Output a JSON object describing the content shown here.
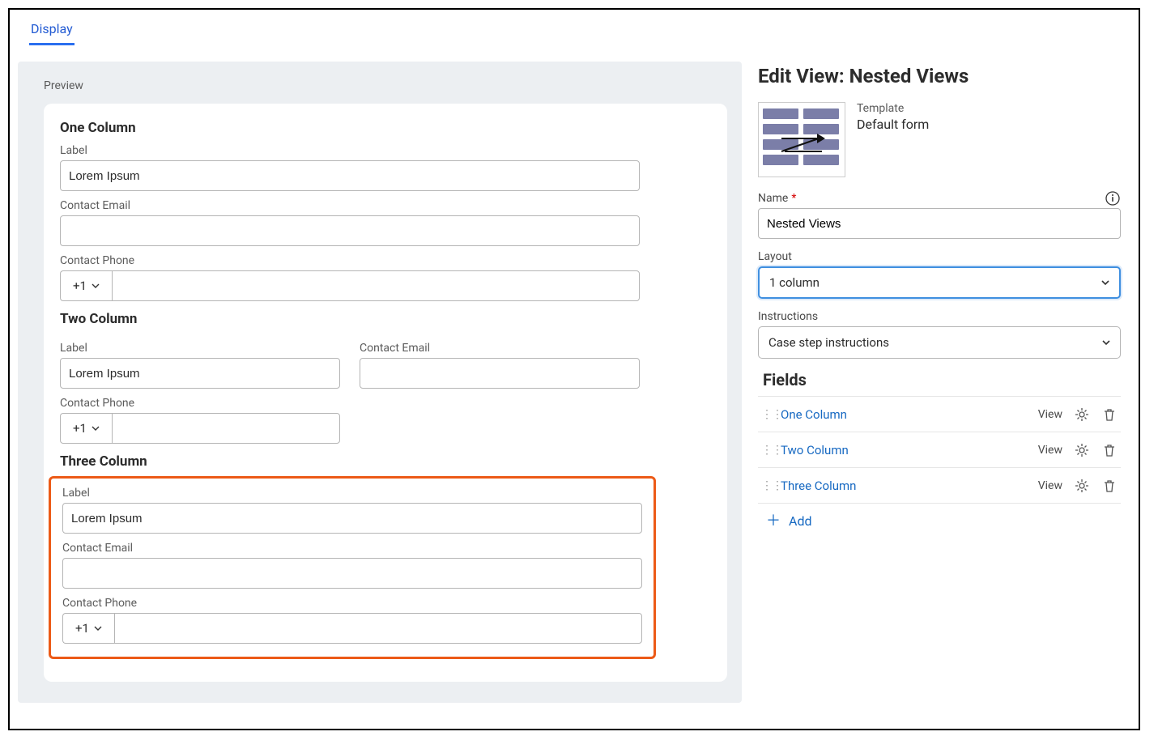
{
  "tabs": {
    "display": "Display"
  },
  "preview": {
    "title": "Preview",
    "sections": {
      "one": {
        "header": "One Column"
      },
      "two": {
        "header": "Two Column"
      },
      "three": {
        "header": "Three Column"
      }
    },
    "fieldLabels": {
      "label": "Label",
      "email": "Contact Email",
      "phone": "Contact Phone"
    },
    "values": {
      "label": "Lorem Ipsum",
      "phonePrefix": "+1"
    }
  },
  "side": {
    "title": "Edit View: Nested Views",
    "templateLabel": "Template",
    "templateValue": "Default form",
    "nameLabel": "Name",
    "nameValue": "Nested Views",
    "layoutLabel": "Layout",
    "layoutValue": "1 column",
    "instructionsLabel": "Instructions",
    "instructionsValue": "Case step instructions",
    "fieldsHeader": "Fields",
    "viewBadge": "View",
    "items": [
      {
        "label": "One Column"
      },
      {
        "label": "Two Column"
      },
      {
        "label": "Three Column"
      }
    ],
    "add": "Add"
  }
}
